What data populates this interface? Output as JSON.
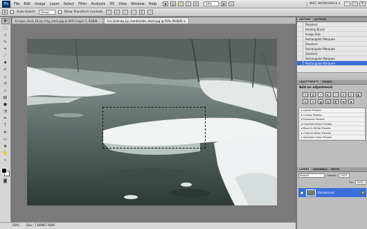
{
  "menubar": {
    "logo": "Ps",
    "items": [
      "File",
      "Edit",
      "Image",
      "Layer",
      "Select",
      "Filter",
      "Analysis",
      "3D",
      "View",
      "Window",
      "Help"
    ],
    "zoom": "50%",
    "workspace": "MIST WORKSPACE ▾",
    "icons": [
      "br-icon",
      "mb-icon",
      "hand-icon",
      "zoom-icon",
      "rotate-icon",
      "arrange-icon",
      "screen-mode-icon"
    ]
  },
  "optionsbar": {
    "auto_select_label": "Auto-Select:",
    "auto_select_value": "Group",
    "show_transform_label": "Show Transform Controls"
  },
  "tabs": [
    "Escape_stock_HI_by_frag_stock.jpg @ 66% (Layer 1, RGB/8...",
    "Ice_Outcrop_by_mardinsdes_stock.jpg @ 50% (RGB/8) ×"
  ],
  "status": {
    "zoom": "50%",
    "doc": "Doc: 7.66M/7.66M"
  },
  "history": {
    "tabs": [
      "HISTORY",
      "ACTIONS"
    ],
    "rows": [
      "Deselect",
      "Healing Brush",
      "Image Size",
      "Rectangular Marquee",
      "Deselect",
      "Rectangular Marquee",
      "Deselect",
      "Rectangular Marquee",
      "Rectangular Marquee"
    ],
    "active_index": 8
  },
  "adjustments": {
    "tabs": [
      "ADJUSTMENTS",
      "MASKS"
    ],
    "heading": "Add an adjustment",
    "icons": [
      "brightness-icon",
      "levels-icon",
      "curves-icon",
      "exposure-icon",
      "vibrance-icon",
      "hue-icon",
      "color-balance-icon",
      "bw-icon",
      "photo-filter-icon",
      "channel-mixer-icon",
      "invert-icon",
      "posterize-icon",
      "threshold-icon",
      "gradient-map-icon",
      "selective-color-icon"
    ],
    "presets": [
      "Levels Presets",
      "Curves Presets",
      "Exposure Presets",
      "Hue/Saturation Presets",
      "Black & White Presets",
      "Channel Mixer Presets",
      "Selective Color Presets"
    ]
  },
  "layers": {
    "tabs": [
      "LAYERS",
      "CHANNELS",
      "PATHS"
    ],
    "blend_mode": "Normal",
    "opacity_label": "Opacity:",
    "opacity": "100%",
    "fill_label": "Fill:",
    "fill": "100%",
    "layer_name": "Background"
  },
  "colors": {
    "accent": "#3a6fd8",
    "foreground": "#000000",
    "background": "#ffffff"
  }
}
